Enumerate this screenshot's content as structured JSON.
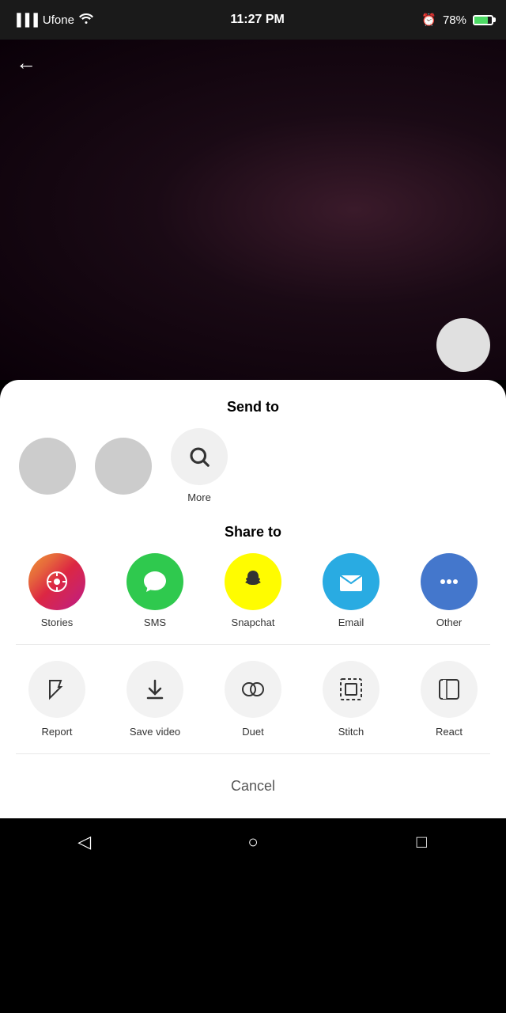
{
  "statusBar": {
    "carrier": "Ufone",
    "time": "11:27 PM",
    "battery": "78%"
  },
  "header": {
    "title": "Send to"
  },
  "sendToRow": {
    "items": [
      {
        "label": "More",
        "type": "search"
      }
    ]
  },
  "shareTo": {
    "title": "Share to",
    "items": [
      {
        "id": "stories",
        "label": "Stories",
        "color": "gradient",
        "icon": "plus"
      },
      {
        "id": "sms",
        "label": "SMS",
        "color": "#2fc94e",
        "icon": "chat"
      },
      {
        "id": "snapchat",
        "label": "Snapchat",
        "color": "#fffc00",
        "icon": "ghost"
      },
      {
        "id": "email",
        "label": "Email",
        "color": "#29abe2",
        "icon": "envelope"
      },
      {
        "id": "other",
        "label": "Other",
        "color": "#4477cc",
        "icon": "dots"
      }
    ]
  },
  "actions": {
    "items": [
      {
        "id": "report",
        "label": "Report",
        "icon": "flag"
      },
      {
        "id": "save-video",
        "label": "Save video",
        "icon": "download"
      },
      {
        "id": "duet",
        "label": "Duet",
        "icon": "duet"
      },
      {
        "id": "stitch",
        "label": "Stitch",
        "icon": "stitch"
      },
      {
        "id": "react",
        "label": "React",
        "icon": "react"
      }
    ]
  },
  "cancel": {
    "label": "Cancel"
  },
  "nav": {
    "back": "◁",
    "home": "○",
    "recent": "□"
  }
}
